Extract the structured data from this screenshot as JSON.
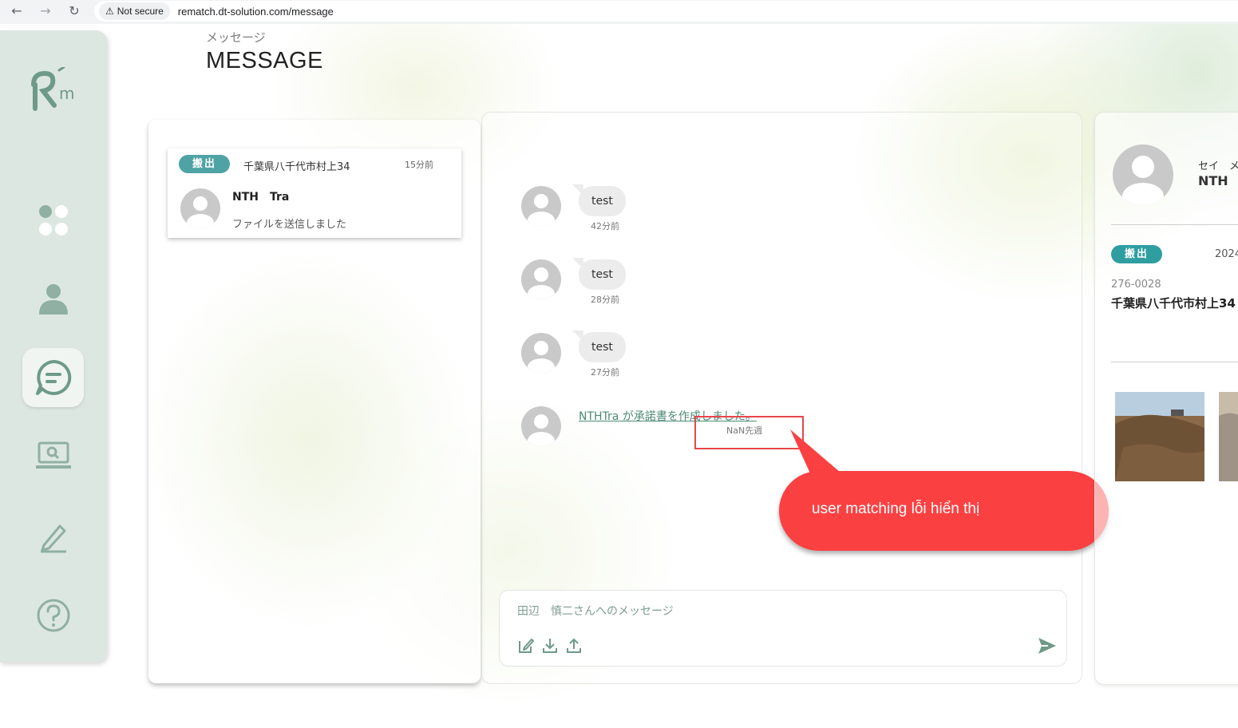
{
  "browser": {
    "security_label": "Not secure",
    "url": "rematch.dt-solution.com/message"
  },
  "page": {
    "title_sub": "メッセージ",
    "title_main": "MESSAGE"
  },
  "sidebar": {
    "items": [
      {
        "name": "dashboard",
        "icon": "grid-icon"
      },
      {
        "name": "profile",
        "icon": "user-icon"
      },
      {
        "name": "messages",
        "icon": "chat-icon",
        "active": true
      },
      {
        "name": "search",
        "icon": "laptop-search-icon"
      },
      {
        "name": "edit",
        "icon": "pen-icon"
      },
      {
        "name": "help",
        "icon": "help-icon"
      }
    ]
  },
  "conversation": {
    "badge": "搬出",
    "address": "千葉県八千代市村上34",
    "time": "15分前",
    "name": "NTH　Tra",
    "preview": "ファイルを送信しました"
  },
  "messages": [
    {
      "text": "test",
      "time": "42分前"
    },
    {
      "text": "test",
      "time": "28分前"
    },
    {
      "text": "test",
      "time": "27分前"
    }
  ],
  "system_message": {
    "text": "NTHTra が承諾書を作成しました。",
    "time": "NaN先週"
  },
  "composer": {
    "placeholder": "田辺　慎二さんへのメッセージ"
  },
  "annotation": {
    "text": "user matching lỗi hiển thị",
    "color": "#fb4042"
  },
  "detail": {
    "kana": "セイ　メ",
    "name": "NTH",
    "badge": "搬出",
    "date": "2024",
    "zip": "276-0028",
    "address": "千葉県八千代市村上34"
  },
  "colors": {
    "accent": "#4fa3a5",
    "sidebar": "#dde7e2",
    "icon": "#8fb0a2"
  }
}
